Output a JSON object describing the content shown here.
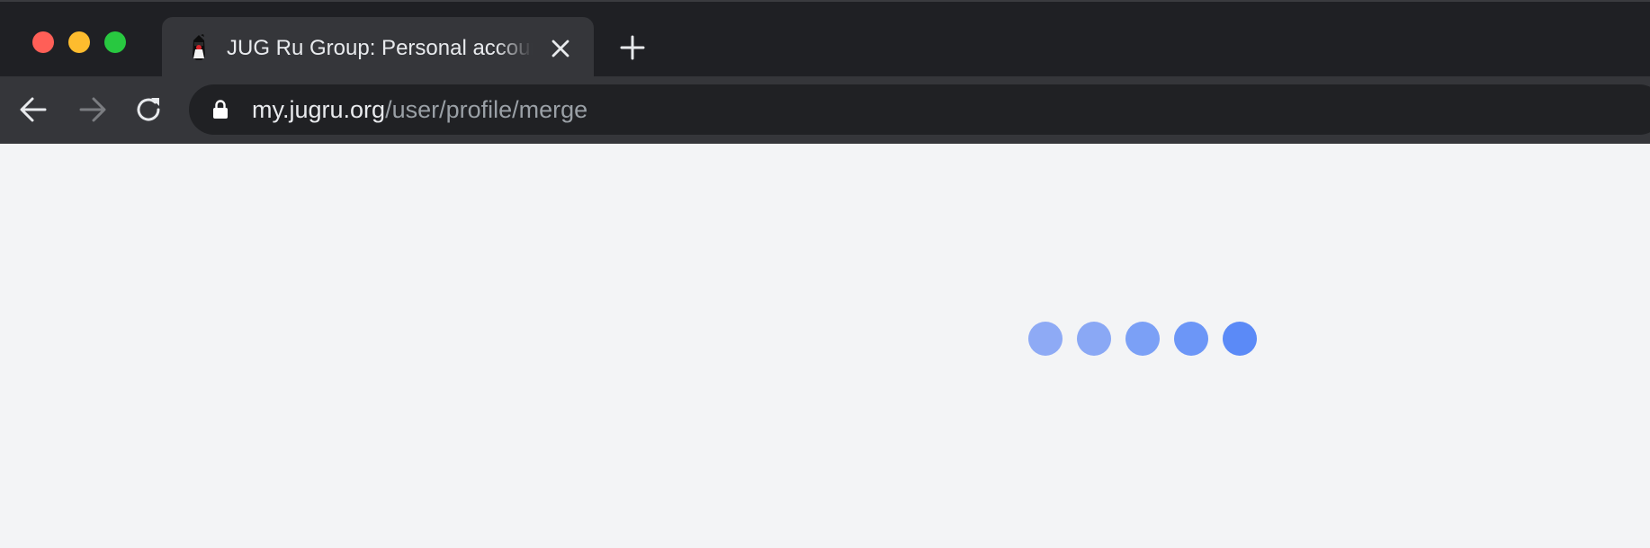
{
  "window": {
    "traffic_lights": {
      "close_color": "#ff5f57",
      "minimize_color": "#febc2e",
      "maximize_color": "#28c840"
    }
  },
  "tab": {
    "title": "JUG Ru Group: Personal account",
    "favicon": "jug-duke-mascot-icon",
    "close_icon": "close-icon"
  },
  "new_tab": {
    "icon": "plus-icon"
  },
  "toolbar": {
    "back_icon": "arrow-left-icon",
    "forward_icon": "arrow-right-icon",
    "reload_icon": "reload-icon",
    "forward_enabled": false
  },
  "address_bar": {
    "lock_icon": "lock-icon",
    "host": "my.jugru.org",
    "path": "/user/profile/merge"
  },
  "page": {
    "loading": true,
    "loader_dot_colors": [
      "#8eaaf5",
      "#8aa8f5",
      "#7ba0f6",
      "#6c96f7",
      "#5b8af7"
    ]
  }
}
